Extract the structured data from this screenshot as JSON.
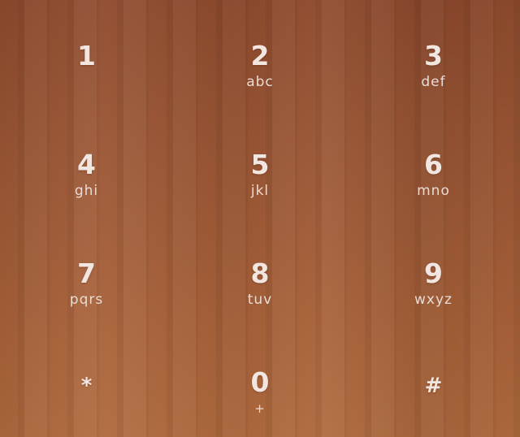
{
  "dialpad": {
    "keys": [
      {
        "digit": "1",
        "letters": ""
      },
      {
        "digit": "2",
        "letters": "abc"
      },
      {
        "digit": "3",
        "letters": "def"
      },
      {
        "digit": "4",
        "letters": "ghi"
      },
      {
        "digit": "5",
        "letters": "jkl"
      },
      {
        "digit": "6",
        "letters": "mno"
      },
      {
        "digit": "7",
        "letters": "pqrs"
      },
      {
        "digit": "8",
        "letters": "tuv"
      },
      {
        "digit": "9",
        "letters": "wxyz"
      },
      {
        "digit": "*",
        "letters": ""
      },
      {
        "digit": "0",
        "letters": "+"
      },
      {
        "digit": "#",
        "letters": ""
      }
    ]
  },
  "colors": {
    "background": "#9b5634",
    "key_text": "#f2e6e0"
  }
}
